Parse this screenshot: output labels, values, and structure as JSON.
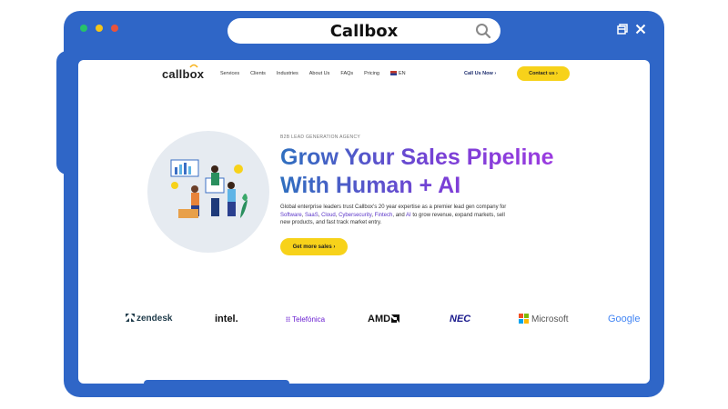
{
  "window": {
    "title": "Callbox",
    "dot_colors": [
      "#27c26a",
      "#f5c518",
      "#e8533c"
    ]
  },
  "nav": {
    "logo": "callbox",
    "links": [
      "Services",
      "Clients",
      "Industries",
      "About Us",
      "FAQs",
      "Pricing",
      "EN"
    ],
    "call_us": "Call Us Now",
    "contact": "Contact us"
  },
  "hero": {
    "eyebrow": "B2B LEAD GENERATION AGENCY",
    "title_line1": "Grow Your Sales Pipeline",
    "title_line2": "With Human + AI",
    "body_part1": "Global enterprise leaders trust Callbox's 20 year expertise as a premier lead gen company for ",
    "body_hl": [
      "Software",
      "SaaS",
      "Cloud",
      "Cybersecurity",
      "Fintech",
      "AI"
    ],
    "body_part2": " to grow revenue, expand markets, sell new products, and fast track market entry.",
    "cta": "Get more sales"
  },
  "clients": [
    "zendesk",
    "intel.",
    "Telefónica",
    "AMD",
    "NEC",
    "Microsoft",
    "Google"
  ],
  "colors": {
    "brand_blue": "#2f66c7",
    "accent_yellow": "#f7d21a",
    "gradient_start": "#2f6fbf",
    "gradient_end": "#9b3be0"
  }
}
